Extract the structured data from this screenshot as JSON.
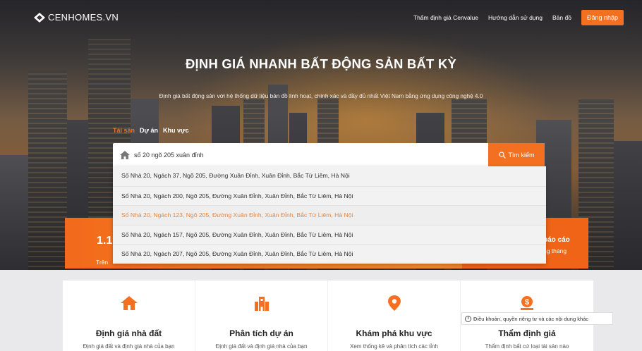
{
  "brand": {
    "name": "CENHOMES.VN"
  },
  "colors": {
    "accent": "#f37021",
    "highlight_text": "#e08a48"
  },
  "nav": {
    "items": [
      "Thẩm định giá Cenvalue",
      "Hướng dẫn sử dụng",
      "Bản đồ"
    ],
    "login_label": "Đăng nhập"
  },
  "hero": {
    "title": "ĐỊNH GIÁ NHANH BẤT ĐỘNG SẢN BẤT KỲ",
    "subtitle": "Định giá bất động sản với hệ thống dữ liệu bản đồ linh hoạt, chính xác và đầy đủ nhất Việt Nam bằng ứng dụng công nghệ 4.0"
  },
  "tabs": [
    {
      "label": "Tài sản",
      "active": true
    },
    {
      "label": "Dự án",
      "active": false
    },
    {
      "label": "Khu vực",
      "active": false
    }
  ],
  "search": {
    "value": "số 20 ngõ 205 xuân đỉnh",
    "button_label": "Tìm kiếm",
    "icons": {
      "left": "home-icon",
      "button": "search-icon"
    }
  },
  "suggestions": [
    "Số Nhà 20, Ngách 37, Ngõ 205, Đường Xuân Đỉnh, Xuân Đỉnh, Bắc Từ Liêm, Hà Nội",
    "Số Nhà 20, Ngách 200, Ngõ 205, Đường Xuân Đỉnh, Xuân Đỉnh, Bắc Từ Liêm, Hà Nội",
    "Số Nhà 20, Ngách 123, Ngõ 205, Đường Xuân Đỉnh, Xuân Đỉnh, Bắc Từ Liêm, Hà Nội",
    "Số Nhà 20, Ngách 157, Ngõ 205, Đường Xuân Đỉnh, Xuân Đỉnh, Bắc Từ Liêm, Hà Nội",
    "Số Nhà 20, Ngách 207, Ngõ 205, Đường Xuân Đỉnh, Xuân Đỉnh, Bắc Từ Liêm, Hà Nội"
  ],
  "highlighted_suggestion_index": 2,
  "stats": {
    "number_fragment": "1.1",
    "sub_fragment": "Trên",
    "report_fragment": "báo cáo",
    "report_sub_fragment": "ng tháng"
  },
  "features": [
    {
      "icon": "house-icon",
      "title": "Định giá nhà đất",
      "desc": "Định giá đất và định giá nhà của bạn"
    },
    {
      "icon": "building-icon",
      "title": "Phân tích dự án",
      "desc": "Định giá đất và định giá nhà của bạn"
    },
    {
      "icon": "map-pin-icon",
      "title": "Khám phá khu vực",
      "desc": "Xem thống kê và phân tích các tỉnh"
    },
    {
      "icon": "money-bag-icon",
      "title": "Thẩm định giá",
      "desc": "Thẩm định bất cứ loại tài sản nào"
    }
  ],
  "footer_tooltip": "Điều khoản, quyền riêng tư và các nội dung khác"
}
